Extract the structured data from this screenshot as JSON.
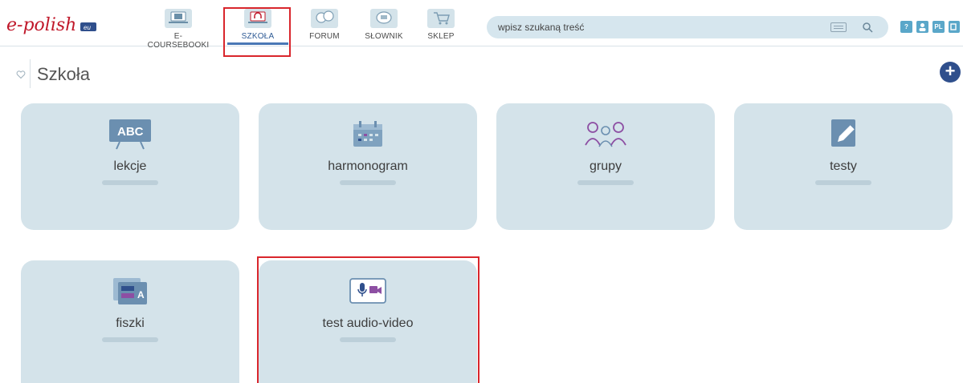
{
  "header": {
    "logo_text": "e-polish",
    "logo_badge": "eu",
    "nav": [
      {
        "label": "E-COURSEBOOKI",
        "icon": "laptop-book-icon"
      },
      {
        "label": "SZKOŁA",
        "icon": "laptop-headphones-icon",
        "active": true
      },
      {
        "label": "FORUM",
        "icon": "speech-bubbles-icon"
      },
      {
        "label": "SŁOWNIK",
        "icon": "dictionary-bubble-icon"
      },
      {
        "label": "SKLEP",
        "icon": "shopping-cart-icon"
      }
    ],
    "search": {
      "placeholder": "wpisz szukaną treść",
      "value": ""
    },
    "utility": [
      {
        "label": "?",
        "icon": "help-icon",
        "color": "#5aa7c9"
      },
      {
        "label": "",
        "icon": "user-icon",
        "color": "#5aa7c9"
      },
      {
        "label": "PL",
        "icon": "language-icon",
        "color": "#5aa7c9"
      },
      {
        "label": "",
        "icon": "logout-icon",
        "color": "#5aa7c9"
      }
    ]
  },
  "page": {
    "title": "Szkoła",
    "add_label": "+"
  },
  "tiles": [
    {
      "label": "lekcje",
      "icon": "abc-board-icon"
    },
    {
      "label": "harmonogram",
      "icon": "calendar-icon"
    },
    {
      "label": "grupy",
      "icon": "group-people-icon"
    },
    {
      "label": "testy",
      "icon": "pencil-note-icon"
    },
    {
      "label": "fiszki",
      "icon": "flashcards-icon"
    },
    {
      "label": "test audio-video",
      "icon": "mic-camera-icon"
    }
  ],
  "colors": {
    "tile_bg": "#d4e3ea",
    "accent": "#2f4f8c",
    "highlight": "#d9262c",
    "abc_text": "#ffffff",
    "purple": "#8d4fa3"
  },
  "tile_icon_text": {
    "abc": "ABC",
    "flash": "A"
  }
}
